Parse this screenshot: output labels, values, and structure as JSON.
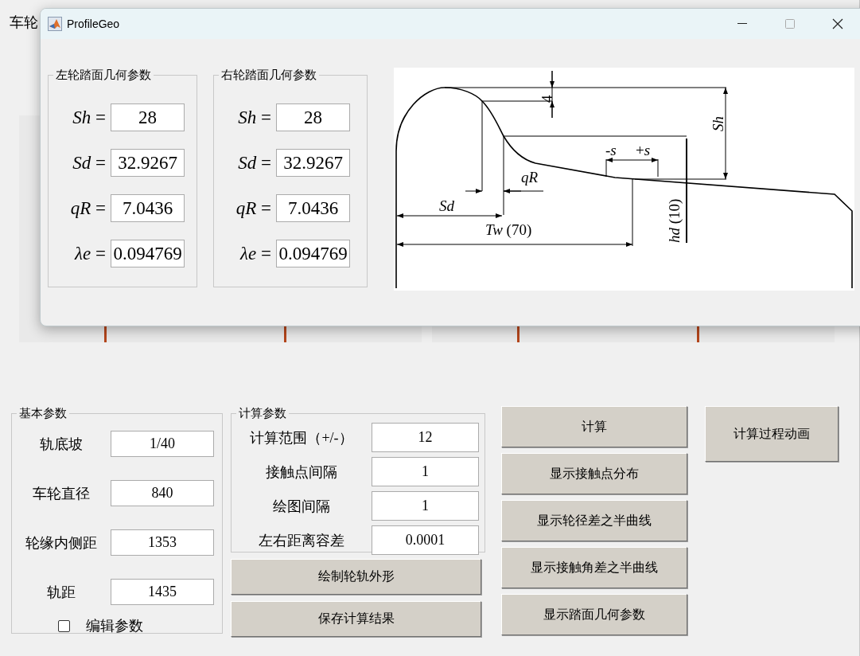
{
  "background_window": {
    "title": "车轮"
  },
  "dialog": {
    "title": "ProfileGeo",
    "panels": [
      {
        "title": "左轮踏面几何参数",
        "params": [
          {
            "symbol": "*Sh* =",
            "value": "28"
          },
          {
            "symbol": "*Sd* =",
            "value": "32.9267"
          },
          {
            "symbol": "*qR* =",
            "value": "7.0436"
          },
          {
            "symbol": "*λe* =",
            "value": "0.094769"
          }
        ]
      },
      {
        "title": "右轮踏面几何参数",
        "params": [
          {
            "symbol": "*Sh* =",
            "value": "28"
          },
          {
            "symbol": "*Sd* =",
            "value": "32.9267"
          },
          {
            "symbol": "*qR* =",
            "value": "7.0436"
          },
          {
            "symbol": "*λe* =",
            "value": "0.094769"
          }
        ]
      }
    ],
    "diagram_labels": [
      "4",
      "*Sh*",
      "-*s*",
      "+*s*",
      "*qR*",
      "*Sd*",
      "*Tw* (70)",
      "*hd* (10)"
    ]
  },
  "basic_params": {
    "title": "基本参数",
    "fields": [
      {
        "label": "轨底坡",
        "value": "1/40"
      },
      {
        "label": "车轮直径",
        "value": "840"
      },
      {
        "label": "轮缘内侧距",
        "value": "1353"
      },
      {
        "label": "轨距",
        "value": "1435"
      }
    ],
    "edit_checkbox": {
      "label": "编辑参数",
      "checked": false
    }
  },
  "calc_params": {
    "title": "计算参数",
    "fields": [
      {
        "label": "计算范围（+/-）",
        "value": "12"
      },
      {
        "label": "接触点间隔",
        "value": "1"
      },
      {
        "label": "绘图间隔",
        "value": "1"
      },
      {
        "label": "左右距离容差",
        "value": "0.0001"
      }
    ]
  },
  "left_buttons": [
    "绘制轮轨外形",
    "保存计算结果"
  ],
  "action_buttons": [
    "计算",
    "显示接触点分布",
    "显示轮径差之半曲线",
    "显示接触角差之半曲线",
    "显示踏面几何参数"
  ],
  "animation_button": "计算过程动画"
}
